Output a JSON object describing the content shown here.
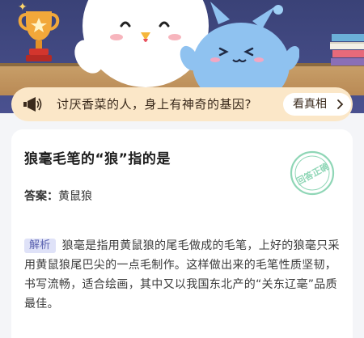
{
  "banner": {
    "scene": "quiz-mascots",
    "accent_colors": {
      "night_sky": "#3f467d",
      "floor": "#c29a63",
      "trophy": "#f0a73a",
      "pet_blue": "#8fc2f0"
    }
  },
  "question_pill": {
    "icon": "megaphone-icon",
    "text": "讨厌香菜的人，身上有神奇的基因?",
    "button_label": "看真相",
    "button_icon": "chevron-right-icon",
    "background": "#fbe7c8"
  },
  "card": {
    "question": "狼毫毛笔的“狼”指的是",
    "answer_label": "答案：",
    "answer_value": "黄鼠狼",
    "stamp_text": "回答正确",
    "stamp_color": "#8fd6b6",
    "explain_tag": "解析",
    "explain_text": "狼毫是指用黄鼠狼的尾毛做成的毛笔，上好的狼毫只采用黄鼠狼尾巴尖的一点毛制作。这样做出来的毛笔性质坚韧，书写流畅，适合绘画，其中又以我国东北产的“关东辽毫”品质最佳。"
  }
}
